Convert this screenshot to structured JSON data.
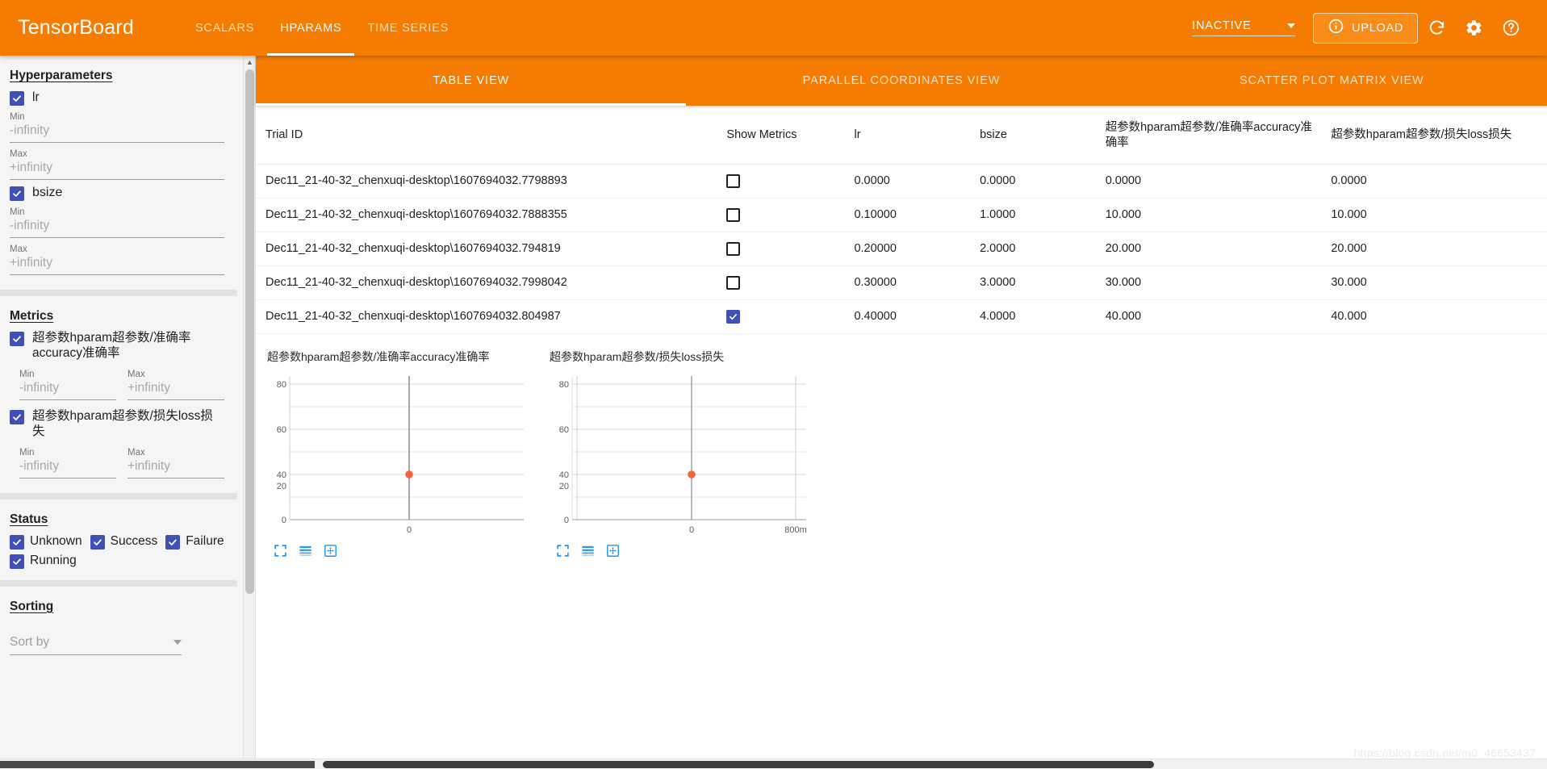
{
  "header": {
    "brand": "TensorBoard",
    "tabs": [
      {
        "label": "SCALARS",
        "active": false
      },
      {
        "label": "HPARAMS",
        "active": true
      },
      {
        "label": "TIME SERIES",
        "active": false
      }
    ],
    "run_status": "INACTIVE",
    "upload_label": "UPLOAD",
    "icons": {
      "info": "info-icon",
      "reload": "reload-icon",
      "settings": "gear-icon",
      "help": "help-icon",
      "dropdown": "chevron-down-icon"
    },
    "accent_color": "#f57c00"
  },
  "sidebar": {
    "hyperparameters": {
      "title": "Hyperparameters",
      "items": [
        {
          "name": "lr",
          "checked": true,
          "min_label": "Min",
          "min_value": "-infinity",
          "max_label": "Max",
          "max_value": "+infinity"
        },
        {
          "name": "bsize",
          "checked": true,
          "min_label": "Min",
          "min_value": "-infinity",
          "max_label": "Max",
          "max_value": "+infinity"
        }
      ]
    },
    "metrics": {
      "title": "Metrics",
      "items": [
        {
          "name": "超参数hparam超参数/准确率accuracy准确率",
          "checked": true,
          "min_label": "Min",
          "min_value": "-infinity",
          "max_label": "Max",
          "max_value": "+infinity"
        },
        {
          "name": "超参数hparam超参数/损失loss损失",
          "checked": true,
          "min_label": "Min",
          "min_value": "-infinity",
          "max_label": "Max",
          "max_value": "+infinity"
        }
      ]
    },
    "status": {
      "title": "Status",
      "items": [
        {
          "label": "Unknown",
          "checked": true
        },
        {
          "label": "Success",
          "checked": true
        },
        {
          "label": "Failure",
          "checked": true
        },
        {
          "label": "Running",
          "checked": true
        }
      ]
    },
    "sorting": {
      "title": "Sorting",
      "sort_by_placeholder": "Sort by",
      "sort_by_value": ""
    },
    "checkbox_color": "#3f51b5"
  },
  "main": {
    "view_tabs": [
      {
        "label": "TABLE VIEW",
        "active": true
      },
      {
        "label": "PARALLEL COORDINATES VIEW",
        "active": false
      },
      {
        "label": "SCATTER PLOT MATRIX VIEW",
        "active": false
      }
    ],
    "table": {
      "columns": [
        "Trial ID",
        "Show Metrics",
        "lr",
        "bsize",
        "超参数hparam超参数/准确率accuracy准确率",
        "超参数hparam超参数/损失loss损失"
      ],
      "rows": [
        {
          "trial_id": "Dec11_21-40-32_chenxuqi-desktop\\1607694032.7798893",
          "show_metrics": false,
          "lr": "0.0000",
          "bsize": "0.0000",
          "accuracy": "0.0000",
          "loss": "0.0000"
        },
        {
          "trial_id": "Dec11_21-40-32_chenxuqi-desktop\\1607694032.7888355",
          "show_metrics": false,
          "lr": "0.10000",
          "bsize": "1.0000",
          "accuracy": "10.000",
          "loss": "10.000"
        },
        {
          "trial_id": "Dec11_21-40-32_chenxuqi-desktop\\1607694032.794819",
          "show_metrics": false,
          "lr": "0.20000",
          "bsize": "2.0000",
          "accuracy": "20.000",
          "loss": "20.000"
        },
        {
          "trial_id": "Dec11_21-40-32_chenxuqi-desktop\\1607694032.7998042",
          "show_metrics": false,
          "lr": "0.30000",
          "bsize": "3.0000",
          "accuracy": "30.000",
          "loss": "30.000"
        },
        {
          "trial_id": "Dec11_21-40-32_chenxuqi-desktop\\1607694032.804987",
          "show_metrics": true,
          "lr": "0.40000",
          "bsize": "4.0000",
          "accuracy": "40.000",
          "loss": "40.000"
        }
      ]
    },
    "chart_tools": [
      "fullscreen-icon",
      "lines-icon",
      "fit-icon"
    ]
  },
  "chart_data": [
    {
      "type": "scatter",
      "title": "超参数hparam超参数/准确率accuracy准确率",
      "xlabel": "",
      "ylabel": "",
      "x": [
        0
      ],
      "y": [
        40
      ],
      "point_color": "#f4643c",
      "yticks": [
        0,
        20,
        40,
        60,
        80
      ],
      "ylim": [
        -10,
        90
      ],
      "xticks": [
        "0"
      ],
      "xtick_positions": [
        0
      ],
      "xlim": [
        -1,
        1
      ],
      "grid": true,
      "legend": "none"
    },
    {
      "type": "scatter",
      "title": "超参数hparam超参数/损失loss损失",
      "xlabel": "",
      "ylabel": "",
      "x": [
        0
      ],
      "y": [
        40
      ],
      "point_color": "#f4643c",
      "yticks": [
        0,
        20,
        40,
        60,
        80
      ],
      "ylim": [
        -10,
        90
      ],
      "xticks": [
        "0",
        "800m"
      ],
      "xtick_positions": [
        0,
        0.8
      ],
      "xlim": [
        -0.15,
        0.95
      ],
      "grid": true,
      "legend": "none"
    }
  ],
  "watermark": "https://blog.csdn.net/m0_46653437"
}
